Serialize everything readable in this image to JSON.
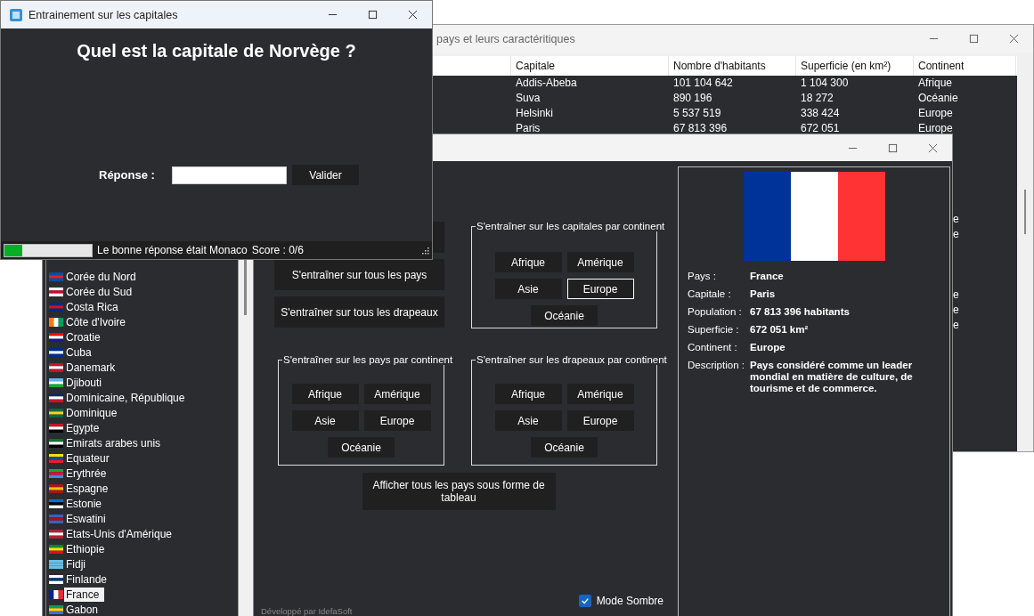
{
  "table_window": {
    "title": "pays et leurs caractéritiques",
    "columns": [
      "Capitale",
      "Nombre d'habitants",
      "Superficie (en km²)",
      "Continent"
    ],
    "rows": [
      {
        "capital": "Addis-Abeba",
        "population": "101 104 642",
        "area": "1 104 300",
        "continent": "Afrique"
      },
      {
        "capital": "Suva",
        "population": "890 196",
        "area": "18 272",
        "continent": "Océanie"
      },
      {
        "capital": "Helsinki",
        "population": "5 537 519",
        "area": "338 424",
        "continent": "Europe"
      },
      {
        "capital": "Paris",
        "population": "67 813 396",
        "area": "672 051",
        "continent": "Europe"
      },
      {},
      {},
      {},
      {},
      {},
      {
        "continent": "e"
      },
      {
        "continent": "e"
      },
      {},
      {},
      {},
      {
        "continent": "e"
      },
      {
        "continent": "e"
      },
      {
        "continent": "e"
      }
    ]
  },
  "main_window": {
    "country_list": [
      {
        "name": "Corée du Nord",
        "selected": false
      },
      {
        "name": "Corée du Sud",
        "selected": false
      },
      {
        "name": "Costa Rica",
        "selected": false
      },
      {
        "name": "Côte d'Ivoire",
        "selected": false
      },
      {
        "name": "Croatie",
        "selected": false
      },
      {
        "name": "Cuba",
        "selected": false
      },
      {
        "name": "Danemark",
        "selected": false
      },
      {
        "name": "Djibouti",
        "selected": false
      },
      {
        "name": "Dominicaine, République",
        "selected": false
      },
      {
        "name": "Dominique",
        "selected": false
      },
      {
        "name": "Egypte",
        "selected": false
      },
      {
        "name": "Emirats arabes unis",
        "selected": false
      },
      {
        "name": "Equateur",
        "selected": false
      },
      {
        "name": "Erythrée",
        "selected": false
      },
      {
        "name": "Espagne",
        "selected": false
      },
      {
        "name": "Estonie",
        "selected": false
      },
      {
        "name": "Eswatini",
        "selected": false
      },
      {
        "name": "Etats-Unis d'Amérique",
        "selected": false
      },
      {
        "name": "Ethiopie",
        "selected": false
      },
      {
        "name": "Fidji",
        "selected": false
      },
      {
        "name": "Finlande",
        "selected": false
      },
      {
        "name": "France",
        "selected": true
      },
      {
        "name": "Gabon",
        "selected": false
      }
    ],
    "buttons": [
      "S'entraîner sur tous les pays",
      "S'entraîner sur tous les drapeaux"
    ],
    "groups": [
      {
        "title": "S'entraîner sur les capitales par continent",
        "buttons": [
          {
            "label": "Afrique",
            "selected": false
          },
          {
            "label": "Amérique",
            "selected": false
          },
          {
            "label": "Asie",
            "selected": false
          },
          {
            "label": "Europe",
            "selected": true
          },
          {
            "label": "Océanie",
            "selected": false
          }
        ]
      },
      {
        "title": "S'entraîner sur les pays par continent",
        "buttons": [
          {
            "label": "Afrique",
            "selected": false
          },
          {
            "label": "Amérique",
            "selected": false
          },
          {
            "label": "Asie",
            "selected": false
          },
          {
            "label": "Europe",
            "selected": false
          },
          {
            "label": "Océanie",
            "selected": false
          }
        ]
      },
      {
        "title": "S'entraîner sur les drapeaux par continent",
        "buttons": [
          {
            "label": "Afrique",
            "selected": false
          },
          {
            "label": "Amérique",
            "selected": false
          },
          {
            "label": "Asie",
            "selected": false
          },
          {
            "label": "Europe",
            "selected": false
          },
          {
            "label": "Océanie",
            "selected": false
          }
        ]
      }
    ],
    "table_button": "Afficher tous les pays sous forme de tableau",
    "dark_mode": {
      "label": "Mode Sombre",
      "checked": true
    },
    "footer": "Développé par IdefaSoft",
    "details": [
      {
        "label": "Pays :",
        "value": "France"
      },
      {
        "label": "Capitale :",
        "value": "Paris"
      },
      {
        "label": "Population :",
        "value": "67 813 396 habitants"
      },
      {
        "label": "Superficie :",
        "value": "672 051 km²"
      },
      {
        "label": "Continent :",
        "value": "Europe"
      },
      {
        "label": "Description :",
        "value": "Pays considéré comme un leader mondial en matière de culture, de tourisme et de commerce."
      }
    ]
  },
  "quiz_window": {
    "title": "Entrainement sur les capitales",
    "question": "Quel est la capitale de Norvège ?",
    "answer_label": "Réponse :",
    "submit": "Valider",
    "progress": {
      "level": 0.2
    },
    "feedback": "Le bonne réponse était Monaco",
    "score": "Score : 0/6"
  }
}
